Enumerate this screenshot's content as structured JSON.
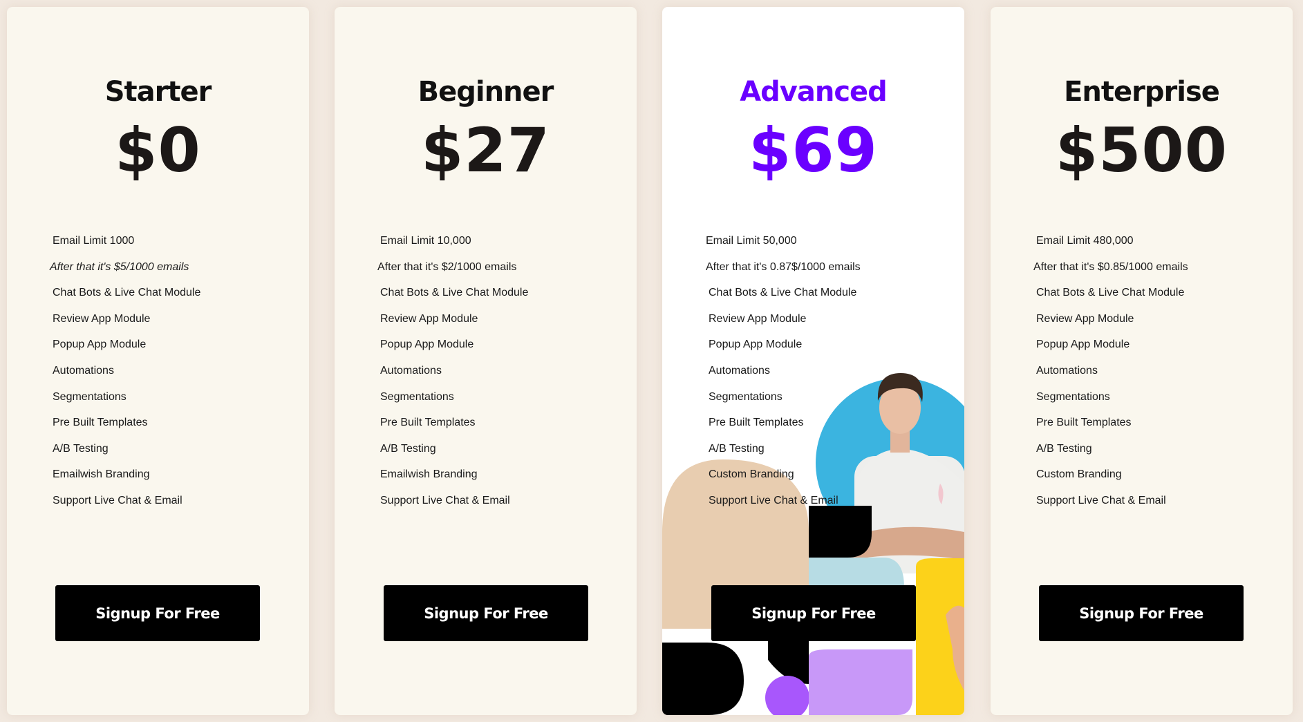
{
  "colors": {
    "page_bg": "#f2e9e0",
    "card_bg": "#faf7ee",
    "featured_card_bg": "#ffffff",
    "accent": "#6a00ff",
    "button_bg": "#000000",
    "button_text": "#ffffff"
  },
  "plans": [
    {
      "name": "Starter",
      "price": "$0",
      "featured": false,
      "features": [
        "Email Limit 1000",
        "After that it's $5/1000 emails",
        "Chat Bots & Live Chat Module",
        "Review App Module",
        "Popup App Module",
        "Automations",
        "Segmentations",
        "Pre Built Templates",
        "A/B Testing",
        "Emailwish Branding",
        "Support Live Chat & Email"
      ],
      "cta": "Signup For Free"
    },
    {
      "name": "Beginner",
      "price": "$27",
      "featured": false,
      "features": [
        "Email Limit 10,000",
        "After that it's $2/1000 emails",
        "Chat Bots & Live Chat Module",
        "Review App Module",
        "Popup App Module",
        "Automations",
        "Segmentations",
        "Pre Built Templates",
        "A/B Testing",
        "Emailwish Branding",
        "Support Live Chat & Email"
      ],
      "cta": "Signup For Free"
    },
    {
      "name": "Advanced",
      "price": "$69",
      "featured": true,
      "features": [
        "Email Limit 50,000",
        "After that it's 0.87$/1000 emails",
        "Chat Bots & Live Chat Module",
        "Review App Module",
        "Popup App Module",
        "Automations",
        "Segmentations",
        "Pre Built Templates",
        "A/B Testing",
        "Custom Branding",
        "Support Live Chat & Email"
      ],
      "cta": "Signup For Free"
    },
    {
      "name": "Enterprise",
      "price": "$500",
      "featured": false,
      "features": [
        "Email Limit 480,000",
        "After that it's $0.85/1000 emails",
        "Chat Bots & Live Chat Module",
        "Review App Module",
        "Popup App Module",
        "Automations",
        "Segmentations",
        "Pre Built Templates",
        "A/B Testing",
        "Custom Branding",
        "Support Live Chat & Email"
      ],
      "cta": "Signup For Free"
    }
  ]
}
